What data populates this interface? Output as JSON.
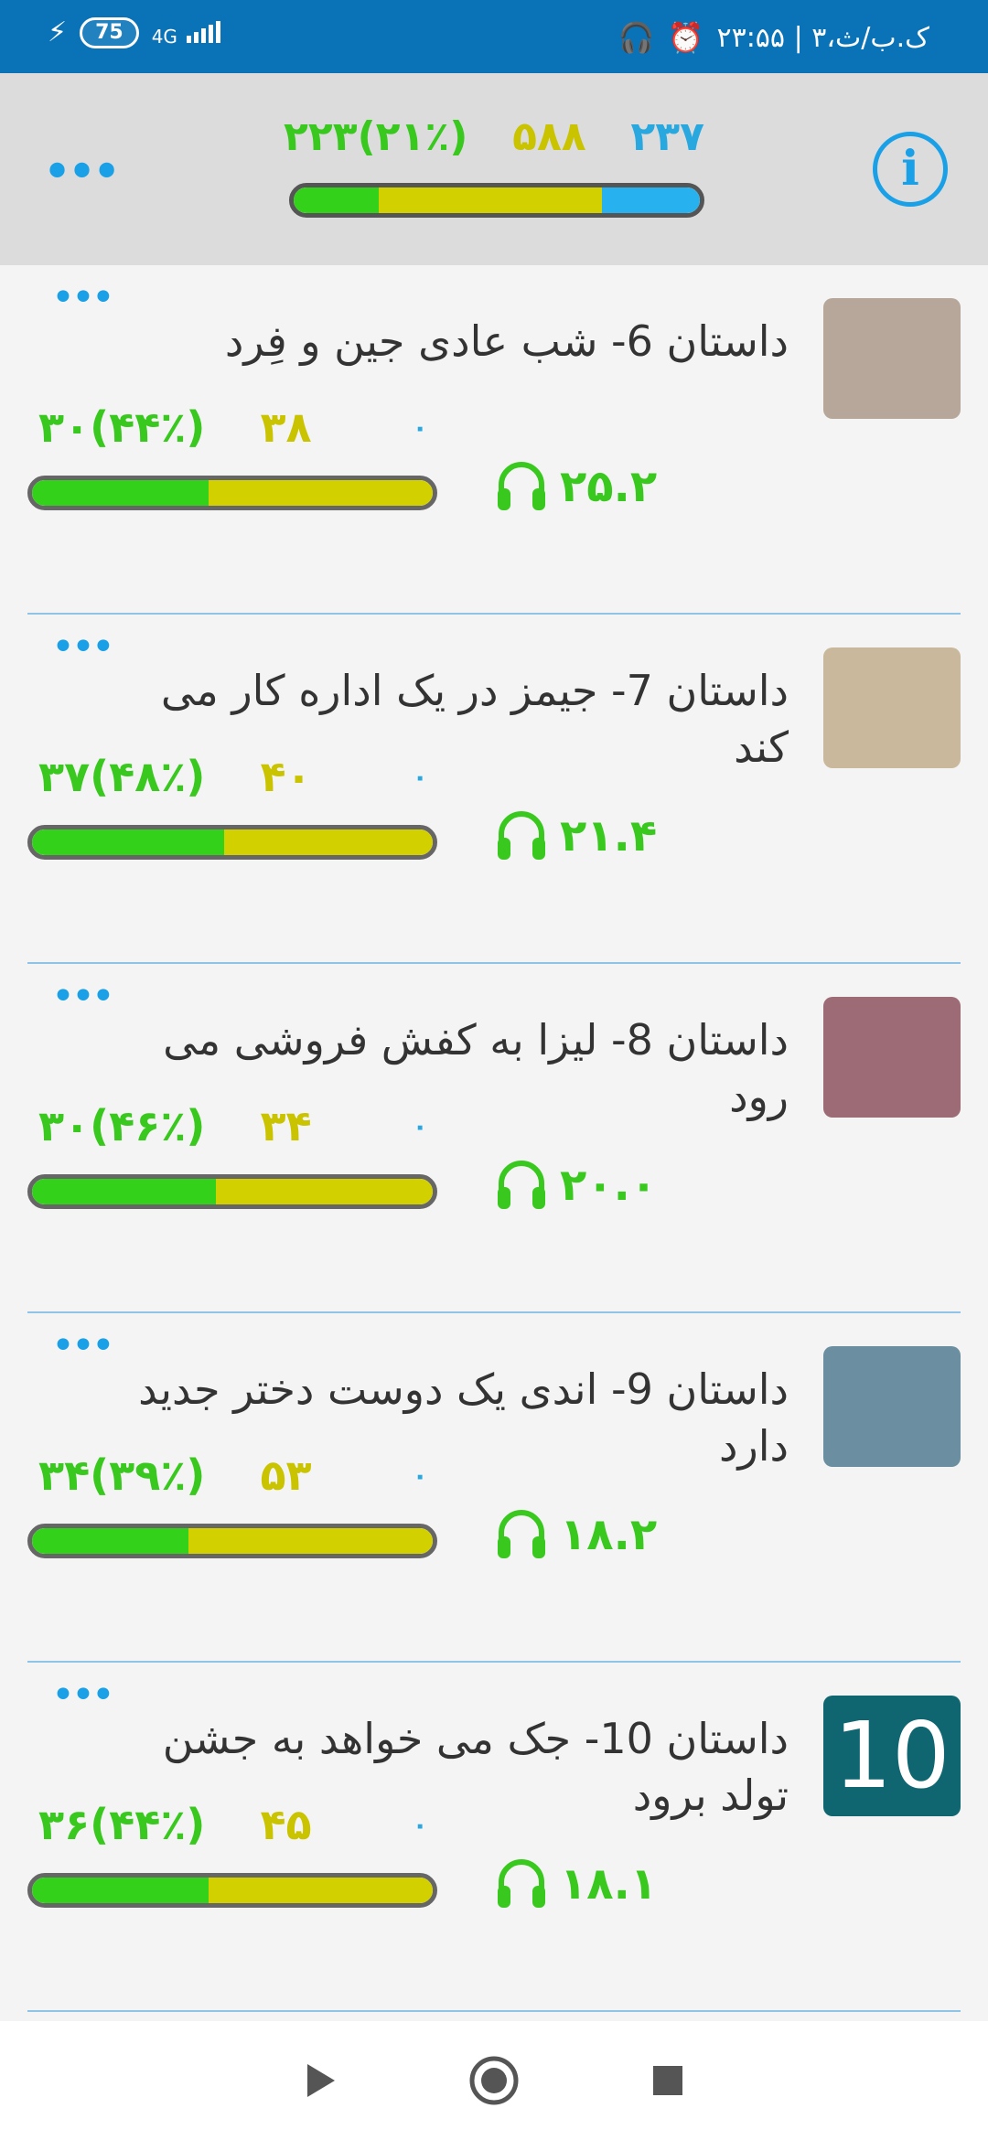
{
  "status_bar": {
    "battery": "75",
    "network": "4G",
    "time_date": "۲۳:۵۵ | ۳،ک.ب/ث"
  },
  "header": {
    "stats": {
      "green": "۲۲۳(۲۱٪)",
      "yellow": "۵۸۸",
      "blue": "۲۳۷"
    },
    "progress": {
      "green": 0.21,
      "yellow": 0.55,
      "blue": 0.24
    }
  },
  "stories": [
    {
      "title": "داستان 6- شب عادی جین و فِرد",
      "green": "۳۰(۴۴٪)",
      "yellow": "۳۸",
      "blue": "۰",
      "duration": "۲۵.۲",
      "progress": {
        "green": 0.44,
        "yellow": 0.56
      },
      "thumb_color": "#b6a79a"
    },
    {
      "title": "داستان 7- جیمز در یک اداره کار می کند",
      "green": "۳۷(۴۸٪)",
      "yellow": "۴۰",
      "blue": "۰",
      "duration": "۲۱.۴",
      "progress": {
        "green": 0.48,
        "yellow": 0.52
      },
      "thumb_color": "#c9b89c"
    },
    {
      "title": "داستان 8- لیزا به کفش فروشی می رود",
      "green": "۳۰(۴۶٪)",
      "yellow": "۳۴",
      "blue": "۰",
      "duration": "۲۰.۰",
      "progress": {
        "green": 0.46,
        "yellow": 0.54
      },
      "thumb_color": "#9c6b75"
    },
    {
      "title": "داستان 9- اندی یک دوست دختر جدید دارد",
      "green": "۳۴(۳۹٪)",
      "yellow": "۵۳",
      "blue": "۰",
      "duration": "۱۸.۲",
      "progress": {
        "green": 0.39,
        "yellow": 0.61
      },
      "thumb_color": "#6b8fa0"
    },
    {
      "title": "داستان 10- جک می خواهد به جشن تولد برود",
      "green": "۳۶(۴۴٪)",
      "yellow": "۴۵",
      "blue": "۰",
      "duration": "۱۸.۱",
      "progress": {
        "green": 0.44,
        "yellow": 0.56
      },
      "thumb_color": "#0f6670",
      "thumb_text": "10"
    }
  ],
  "colors": {
    "accent": "#1aa0e6",
    "green": "#33d11a",
    "yellow": "#d3d000",
    "blue": "#27b2ef"
  }
}
